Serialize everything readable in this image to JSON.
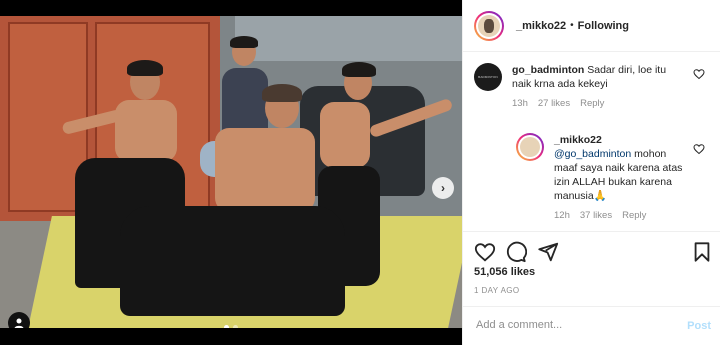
{
  "post": {
    "username": "_mikko22",
    "separator": "•",
    "follow_status": "Following"
  },
  "comments": [
    {
      "username": "go_badminton",
      "text": "Sadar diri, loe itu naik krna ada kekeyi",
      "time": "13h",
      "likes": "27 likes",
      "reply": "Reply"
    },
    {
      "username": "_mikko22",
      "mention": "@go_badminton",
      "text": "mohon maaf saya naik karena atas izin ALLAH bukan karena manusia🙏",
      "time": "12h",
      "likes": "37 likes",
      "reply": "Reply"
    }
  ],
  "likes_count": "51,056 likes",
  "date": "1 DAY AGO",
  "add_comment": {
    "placeholder": "Add a comment...",
    "post_label": "Post"
  },
  "colors": {
    "mention": "#00376b",
    "post_button_disabled": "#b2dffc",
    "meta_gray": "#8e8e8e"
  },
  "icons": [
    "heart-icon",
    "comment-icon",
    "share-icon",
    "bookmark-icon",
    "user-tag-icon",
    "chevron-right-icon"
  ]
}
